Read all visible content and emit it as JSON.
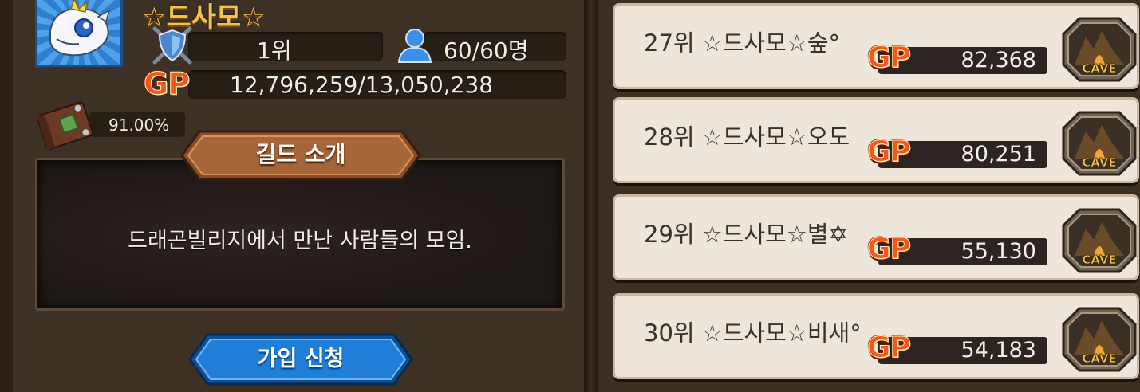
{
  "guild": {
    "name": "☆드사모☆",
    "rank": "1위",
    "members": "60/60명",
    "gp": "12,796,259/13,050,238",
    "progress_pct": "91.00%"
  },
  "intro": {
    "title": "길드 소개",
    "text": "드래곤빌리지에서 만난 사람들의 모임."
  },
  "join_button": "가입 신청",
  "gp_label": "GP",
  "cave_label": "CAVE",
  "ranking": [
    {
      "title": "27위 ☆드사모☆숲°",
      "gp": "82,368"
    },
    {
      "title": "28위 ☆드사모☆오도",
      "gp": "80,251"
    },
    {
      "title": "29위 ☆드사모☆별✡",
      "gp": "55,130"
    },
    {
      "title": "30위 ☆드사모☆비새°",
      "gp": "54,183"
    }
  ],
  "colors": {
    "panel_bg": "#3d3126",
    "name_gold": "#f0c44a",
    "card_bg": "#eee6da",
    "gp_orange": "#f2581a",
    "join_blue": "#1f7fd8"
  },
  "icons": [
    "dragon-emblem-icon",
    "shield-icon",
    "person-icon",
    "book-icon",
    "cave-icon"
  ]
}
